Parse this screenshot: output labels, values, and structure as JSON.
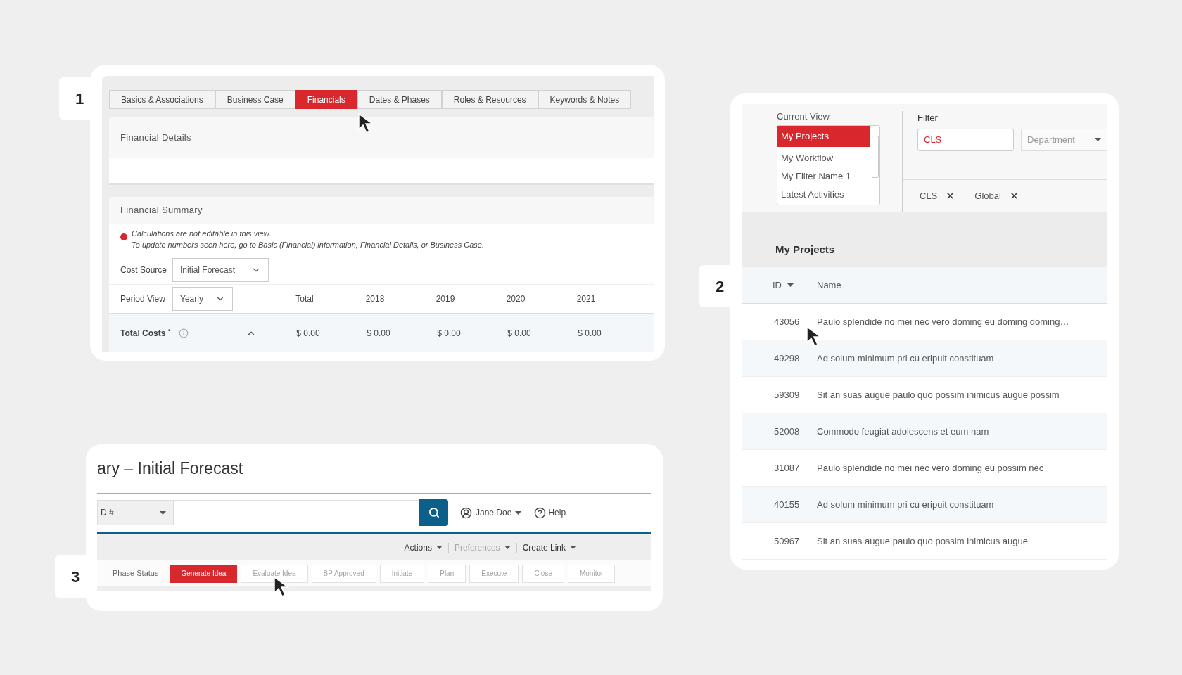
{
  "panel_1": {
    "badge": "1",
    "tabs": [
      {
        "label": "Basics & Associations",
        "selected": false
      },
      {
        "label": "Business Case",
        "selected": false
      },
      {
        "label": "Financials",
        "selected": true
      },
      {
        "label": "Dates & Phases",
        "selected": false
      },
      {
        "label": "Roles & Resources",
        "selected": false
      },
      {
        "label": "Keywords & Notes",
        "selected": false
      }
    ],
    "financial_details": {
      "title": "Financial Details"
    },
    "financial_summary": {
      "title": "Financial Summary",
      "notice": [
        "Calculations are not editable in this view.",
        "To update numbers seen here, go to Basic (Financial) information, Financial Details, or Business Case."
      ],
      "cost_source": {
        "label": "Cost Source",
        "value": "Initial Forecast"
      },
      "period_view": {
        "label": "Period View",
        "value": "Yearly"
      },
      "columns": [
        "Total",
        "2018",
        "2019",
        "2020",
        "2021"
      ],
      "total_costs": {
        "label": "Total Costs $^{•}$",
        "expanded": true,
        "values": [
          "$ 0.00",
          "$ 0.00",
          "$ 0.00",
          "$ 0.00",
          "$ 0.00"
        ]
      }
    }
  },
  "panel_2": {
    "badge": "2",
    "current_view": {
      "label": "Current View",
      "items": [
        {
          "label": "My Projects",
          "selected": true
        },
        {
          "label": "My Workflow",
          "selected": false
        },
        {
          "label": "My Filter Name 1",
          "selected": false
        },
        {
          "label": "Latest Activities",
          "selected": false
        }
      ]
    },
    "filter": {
      "label": "Filter",
      "value": "CLS",
      "dropdown_placeholder": "Department",
      "chips": [
        "CLS",
        "Global"
      ]
    },
    "list_title": "My Projects",
    "columns": [
      "ID",
      "Name"
    ],
    "rows": [
      {
        "id": "43056",
        "name": "Paulo splendide no mei nec vero doming eu doming doming…"
      },
      {
        "id": "49298",
        "name": "Ad solum minimum pri cu eripuit constituam"
      },
      {
        "id": "59309",
        "name": "Sit an suas augue paulo quo possim inimicus augue possim"
      },
      {
        "id": "52008",
        "name": "Commodo feugiat adolescens et eum nam"
      },
      {
        "id": "31087",
        "name": "Paulo splendide no mei nec vero doming eu possim nec"
      },
      {
        "id": "40155",
        "name": "Ad solum minimum pri cu eripuit constituam"
      },
      {
        "id": "50967",
        "name": "Sit an suas augue paulo quo possim inimicus augue"
      }
    ]
  },
  "panel_3": {
    "badge": "3",
    "title": "ary – Initial Forecast",
    "search_select": "D #",
    "user": "Jane Doe",
    "help": "Help",
    "menu": [
      {
        "label": "Actions",
        "disabled": false
      },
      {
        "label": "Preferences",
        "disabled": true
      },
      {
        "label": "Create Link",
        "disabled": false
      }
    ],
    "phase_label": "Phase Status",
    "phases": [
      {
        "label": "Generate Idea",
        "selected": true
      },
      {
        "label": "Evaluate Idea",
        "selected": false
      },
      {
        "label": "BP Approved",
        "selected": false
      },
      {
        "label": "Initiate",
        "selected": false
      },
      {
        "label": "Plan",
        "selected": false
      },
      {
        "label": "Execute",
        "selected": false
      },
      {
        "label": "Close",
        "selected": false
      },
      {
        "label": "Monitor",
        "selected": false
      }
    ]
  }
}
